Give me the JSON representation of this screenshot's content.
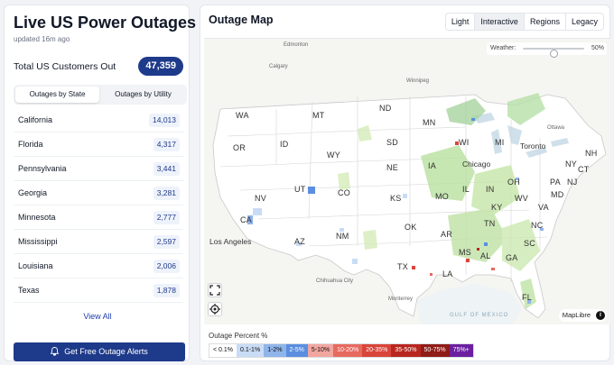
{
  "left": {
    "title": "Live US Power Outages",
    "updated": "updated 16m ago",
    "total_label": "Total US Customers Out",
    "total_value": "47,359",
    "tabs": [
      "Outages by State",
      "Outages by Utility"
    ],
    "states": [
      {
        "name": "California",
        "value": "14,013"
      },
      {
        "name": "Florida",
        "value": "4,317"
      },
      {
        "name": "Pennsylvania",
        "value": "3,441"
      },
      {
        "name": "Georgia",
        "value": "3,281"
      },
      {
        "name": "Minnesota",
        "value": "2,777"
      },
      {
        "name": "Mississippi",
        "value": "2,597"
      },
      {
        "name": "Louisiana",
        "value": "2,006"
      },
      {
        "name": "Texas",
        "value": "1,878"
      }
    ],
    "view_all": "View All",
    "alert_button": "Get Free Outage Alerts"
  },
  "map_panel": {
    "title": "Outage Map",
    "views": [
      "Light",
      "Interactive",
      "Regions",
      "Legacy"
    ],
    "active_view": "Interactive",
    "weather_label": "Weather:",
    "weather_value": "50%",
    "weather_level": 0.5,
    "state_labels": [
      "WA",
      "MT",
      "ND",
      "MN",
      "OR",
      "ID",
      "SD",
      "WI",
      "MI",
      "WY",
      "NE",
      "IA",
      "NV",
      "UT",
      "CO",
      "KS",
      "MO",
      "IL",
      "IN",
      "OH",
      "PA",
      "NY",
      "CA",
      "OK",
      "KY",
      "WV",
      "VA",
      "AZ",
      "NM",
      "AR",
      "TN",
      "NC",
      "TX",
      "MS",
      "AL",
      "GA",
      "SC",
      "LA",
      "FL",
      "NH",
      "CT",
      "NJ",
      "MD"
    ],
    "city_labels": [
      "Toronto",
      "Chicago",
      "Los Angeles"
    ],
    "minor_labels": [
      "Edmonton",
      "Calgary",
      "Winnipeg",
      "Ottawa",
      "Chihuahua City",
      "Monterrey"
    ],
    "gulf_label": "GULF OF MEXICO",
    "attribution": "MapLibre",
    "info_symbol": "i",
    "legend_title": "Outage Percent %",
    "legend": [
      {
        "label": "< 0.1%",
        "color": "#ffffff",
        "text": "#111111"
      },
      {
        "label": "0.1-1%",
        "color": "#c9dcf5",
        "text": "#111111"
      },
      {
        "label": "1-2%",
        "color": "#8fb4ea",
        "text": "#111111"
      },
      {
        "label": "2-5%",
        "color": "#5b8ee0",
        "text": "#ffffff"
      },
      {
        "label": "5-10%",
        "color": "#f2a6a0",
        "text": "#111111"
      },
      {
        "label": "10-20%",
        "color": "#e76a5f",
        "text": "#ffffff"
      },
      {
        "label": "20-35%",
        "color": "#d9453a",
        "text": "#ffffff"
      },
      {
        "label": "35-50%",
        "color": "#b8271f",
        "text": "#ffffff"
      },
      {
        "label": "50-75%",
        "color": "#8e1c17",
        "text": "#ffffff"
      },
      {
        "label": "75%+",
        "color": "#6b1fa0",
        "text": "#ffffff"
      }
    ]
  },
  "colors": {
    "brand": "#1e3a8a",
    "map_bg": "#f6f6f3"
  }
}
